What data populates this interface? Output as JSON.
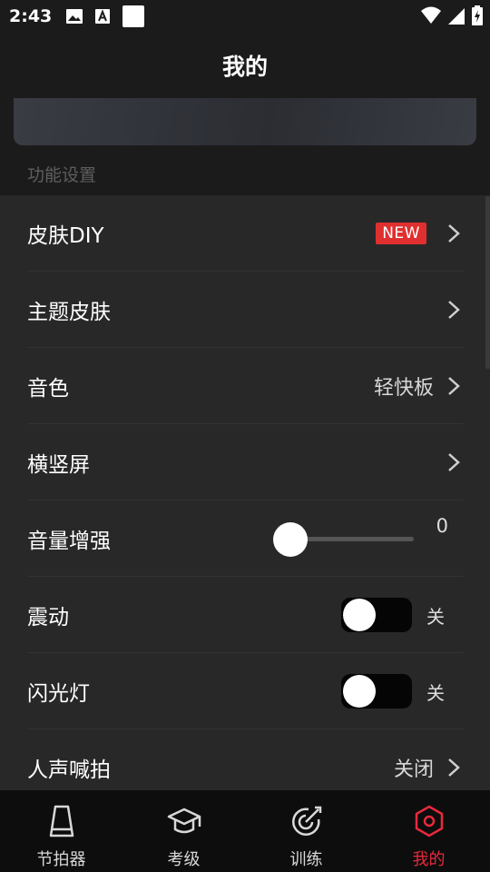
{
  "status_bar": {
    "time": "2:43",
    "icons": [
      "image-icon",
      "font-icon",
      "square-icon",
      "wifi-icon",
      "signal-icon",
      "battery-icon"
    ]
  },
  "header": {
    "title": "我的"
  },
  "section": {
    "title": "功能设置"
  },
  "settings": [
    {
      "label": "皮肤DIY",
      "badge": "NEW"
    },
    {
      "label": "主题皮肤"
    },
    {
      "label": "音色",
      "value": "轻快板"
    },
    {
      "label": "横竖屏"
    },
    {
      "label": "音量增强",
      "slider_value": "0",
      "slider_fraction": 0
    },
    {
      "label": "震动",
      "toggle_text": "关",
      "toggle_on": false
    },
    {
      "label": "闪光灯",
      "toggle_text": "关",
      "toggle_on": false
    },
    {
      "label": "人声喊拍",
      "value": "关闭"
    }
  ],
  "nav": {
    "items": [
      {
        "label": "节拍器",
        "icon": "metronome-icon"
      },
      {
        "label": "考级",
        "icon": "graduation-cap-icon"
      },
      {
        "label": "训练",
        "icon": "target-icon"
      },
      {
        "label": "我的",
        "icon": "hexagon-icon",
        "active": true
      }
    ],
    "active_color": "#e8293b"
  },
  "colors": {
    "badge": "#e02f2f",
    "background": "#1b1b1b",
    "list_background": "#282828"
  }
}
